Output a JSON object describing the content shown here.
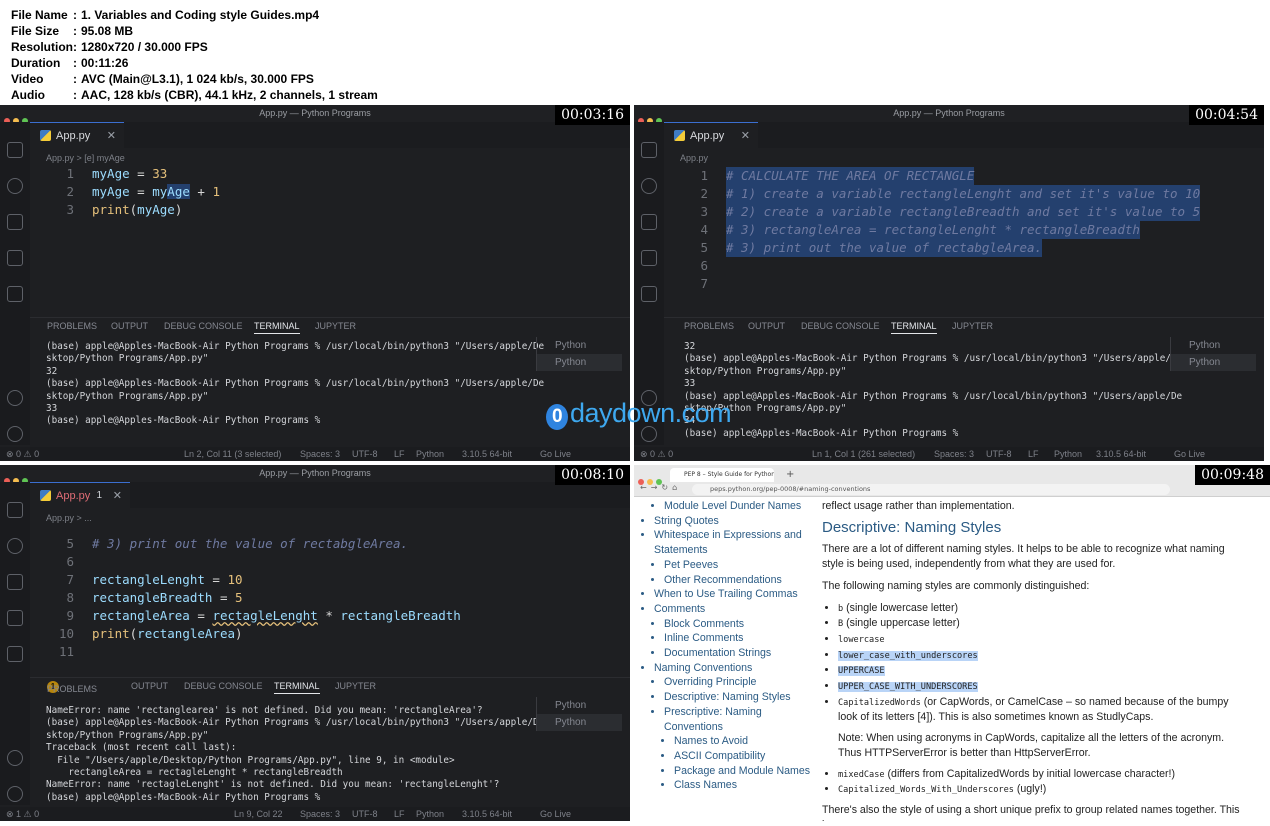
{
  "header": {
    "rows": [
      {
        "key": "File Name",
        "value": "1. Variables and Coding style Guides.mp4"
      },
      {
        "key": "File Size",
        "value": "95.08 MB"
      },
      {
        "key": "Resolution",
        "value": "1280x720 / 30.000 FPS"
      },
      {
        "key": "Duration",
        "value": "00:11:26"
      },
      {
        "key": "Video",
        "value": "AVC (Main@L3.1), 1 024 kb/s, 30.000 FPS"
      },
      {
        "key": "Audio",
        "value": "AAC, 128 kb/s (CBR), 44.1 kHz, 2 channels, 1 stream"
      }
    ],
    "colon": ":"
  },
  "watermark": {
    "glyph": "0",
    "text": "daydown.com"
  },
  "panes": {
    "p1": {
      "timestamp": "00:03:16",
      "window_title": "App.py — Python Programs",
      "tab": "App.py",
      "crumb": "App.py > [e] myAge",
      "lines": [
        {
          "n": "1",
          "code": "myAge = 33"
        },
        {
          "n": "2",
          "code": "myAge = myAge + 1"
        },
        {
          "n": "3",
          "code": "print(myAge)"
        }
      ],
      "panel_tabs": [
        "PROBLEMS",
        "OUTPUT",
        "DEBUG CONSOLE",
        "TERMINAL",
        "JUPYTER"
      ],
      "terminal": "(base) apple@Apples-MacBook-Air Python Programs % /usr/local/bin/python3 \"/Users/apple/De\nsktop/Python Programs/App.py\"\n32\n(base) apple@Apples-MacBook-Air Python Programs % /usr/local/bin/python3 \"/Users/apple/De\nsktop/Python Programs/App.py\"\n33\n(base) apple@Apples-MacBook-Air Python Programs % ",
      "side": [
        "Python",
        "Python"
      ],
      "status_left": "⊗ 0 ⚠ 0",
      "status_right": [
        "Ln 2, Col 11 (3 selected)",
        "Spaces: 3",
        "UTF-8",
        "LF",
        "Python",
        "3.10.5 64-bit",
        "Go Live"
      ]
    },
    "p2": {
      "timestamp": "00:04:54",
      "window_title": "App.py — Python Programs",
      "tab": "App.py",
      "crumb": "App.py",
      "lines": [
        {
          "n": "1",
          "code": "# CALCULATE THE AREA OF RECTANGLE"
        },
        {
          "n": "2",
          "code": "# 1) create a variable rectangleLenght and set it's value to 10"
        },
        {
          "n": "3",
          "code": "# 2) create a variable rectangleBreadth and set it's value to 5"
        },
        {
          "n": "4",
          "code": "# 3) rectangleArea = rectangleLenght * rectangleBreadth"
        },
        {
          "n": "5",
          "code": "# 3) print out the value of rectabgleArea."
        },
        {
          "n": "6",
          "code": ""
        },
        {
          "n": "7",
          "code": ""
        }
      ],
      "panel_tabs": [
        "PROBLEMS",
        "OUTPUT",
        "DEBUG CONSOLE",
        "TERMINAL",
        "JUPYTER"
      ],
      "terminal": "32\n(base) apple@Apples-MacBook-Air Python Programs % /usr/local/bin/python3 \"/Users/apple/De\nsktop/Python Programs/App.py\"\n33\n(base) apple@Apples-MacBook-Air Python Programs % /usr/local/bin/python3 \"/Users/apple/De\nsktop/Python Programs/App.py\"\n34\n(base) apple@Apples-MacBook-Air Python Programs % ",
      "side": [
        "Python",
        "Python"
      ],
      "status_left": "⊗ 0 ⚠ 0",
      "status_right": [
        "Ln 1, Col 1 (261 selected)",
        "Spaces: 3",
        "UTF-8",
        "LF",
        "Python",
        "3.10.5 64-bit",
        "Go Live"
      ]
    },
    "p3": {
      "timestamp": "00:08:10",
      "window_title": "App.py — Python Programs",
      "tab": "App.py",
      "tab_badge": "1",
      "crumb": "App.py > ...",
      "lines": [
        {
          "n": "5",
          "code": "# 3) print out the value of rectabgleArea."
        },
        {
          "n": "6",
          "code": ""
        },
        {
          "n": "7",
          "code": "rectangleLenght = 10"
        },
        {
          "n": "8",
          "code": "rectangleBreadth = 5"
        },
        {
          "n": "9",
          "code": "rectangleArea = rectagleLenght * rectangleBreadth"
        },
        {
          "n": "10",
          "code": "print(rectangleArea)"
        },
        {
          "n": "11",
          "code": ""
        }
      ],
      "panel_tabs": [
        "PROBLEMS",
        "OUTPUT",
        "DEBUG CONSOLE",
        "TERMINAL",
        "JUPYTER"
      ],
      "problems_count": "1",
      "terminal": "NameError: name 'rectanglearea' is not defined. Did you mean: 'rectangleArea'?\n(base) apple@Apples-MacBook-Air Python Programs % /usr/local/bin/python3 \"/Users/apple/De\nsktop/Python Programs/App.py\"\nTraceback (most recent call last):\n  File \"/Users/apple/Desktop/Python Programs/App.py\", line 9, in <module>\n    rectangleArea = rectagleLenght * rectangleBreadth\nNameError: name 'rectagleLenght' is not defined. Did you mean: 'rectangleLenght'?\n(base) apple@Apples-MacBook-Air Python Programs % ",
      "side": [
        "Python",
        "Python"
      ],
      "status_left": "⊗ 1 ⚠ 0",
      "status_right": [
        "Ln 9, Col 22",
        "Spaces: 3",
        "UTF-8",
        "LF",
        "Python",
        "3.10.5 64-bit",
        "Go Live"
      ]
    },
    "p4": {
      "timestamp": "00:09:48",
      "browser_tab": "PEP 8 – Style Guide for Python",
      "url": "peps.python.org/pep-0008/#naming-conventions",
      "toc": [
        {
          "t": "Module Level Dunder Names",
          "lvl": 2
        },
        {
          "t": "String Quotes",
          "lvl": 1
        },
        {
          "t": "Whitespace in Expressions and Statements",
          "lvl": 1
        },
        {
          "t": "Pet Peeves",
          "lvl": 2
        },
        {
          "t": "Other Recommendations",
          "lvl": 2
        },
        {
          "t": "When to Use Trailing Commas",
          "lvl": 1
        },
        {
          "t": "Comments",
          "lvl": 1
        },
        {
          "t": "Block Comments",
          "lvl": 2
        },
        {
          "t": "Inline Comments",
          "lvl": 2
        },
        {
          "t": "Documentation Strings",
          "lvl": 2
        },
        {
          "t": "Naming Conventions",
          "lvl": 1
        },
        {
          "t": "Overriding Principle",
          "lvl": 2
        },
        {
          "t": "Descriptive: Naming Styles",
          "lvl": 2
        },
        {
          "t": "Prescriptive: Naming Conventions",
          "lvl": 2
        },
        {
          "t": "Names to Avoid",
          "lvl": 3
        },
        {
          "t": "ASCII Compatibility",
          "lvl": 3
        },
        {
          "t": "Package and Module Names",
          "lvl": 3
        },
        {
          "t": "Class Names",
          "lvl": 3
        }
      ],
      "intro": "reflect usage rather than implementation.",
      "heading": "Descriptive: Naming Styles",
      "p1": "There are a lot of different naming styles. It helps to be able to recognize what naming style is being used, independently from what they are used for.",
      "p2": "The following naming styles are commonly distinguished:",
      "styles": [
        {
          "code": "b",
          "rest": " (single lowercase letter)"
        },
        {
          "code": "B",
          "rest": " (single uppercase letter)"
        },
        {
          "code": "lowercase",
          "rest": ""
        },
        {
          "code": "lower_case_with_underscores",
          "rest": "",
          "hl": true
        },
        {
          "code": "UPPERCASE",
          "rest": "",
          "hl": true
        },
        {
          "code": "UPPER_CASE_WITH_UNDERSCORES",
          "rest": "",
          "hl": true
        },
        {
          "code": "CapitalizedWords",
          "rest": " (or CapWords, or CamelCase – so named because of the bumpy look of its letters [4]). This is also sometimes known as StudlyCaps."
        }
      ],
      "note": "Note: When using acronyms in CapWords, capitalize all the letters of the acronym. Thus HTTPServerError is better than HttpServerError.",
      "styles2": [
        {
          "code": "mixedCase",
          "rest": " (differs from CapitalizedWords by initial lowercase character!)"
        },
        {
          "code": "Capitalized_Words_With_Underscores",
          "rest": " (ugly!)"
        }
      ],
      "tail": "There's also the style of using a short unique prefix to group related names together. This is"
    }
  },
  "colors": {
    "editor_bg": "#1e1f22",
    "accent": "#3b6fd1",
    "link": "#2b5b84"
  }
}
